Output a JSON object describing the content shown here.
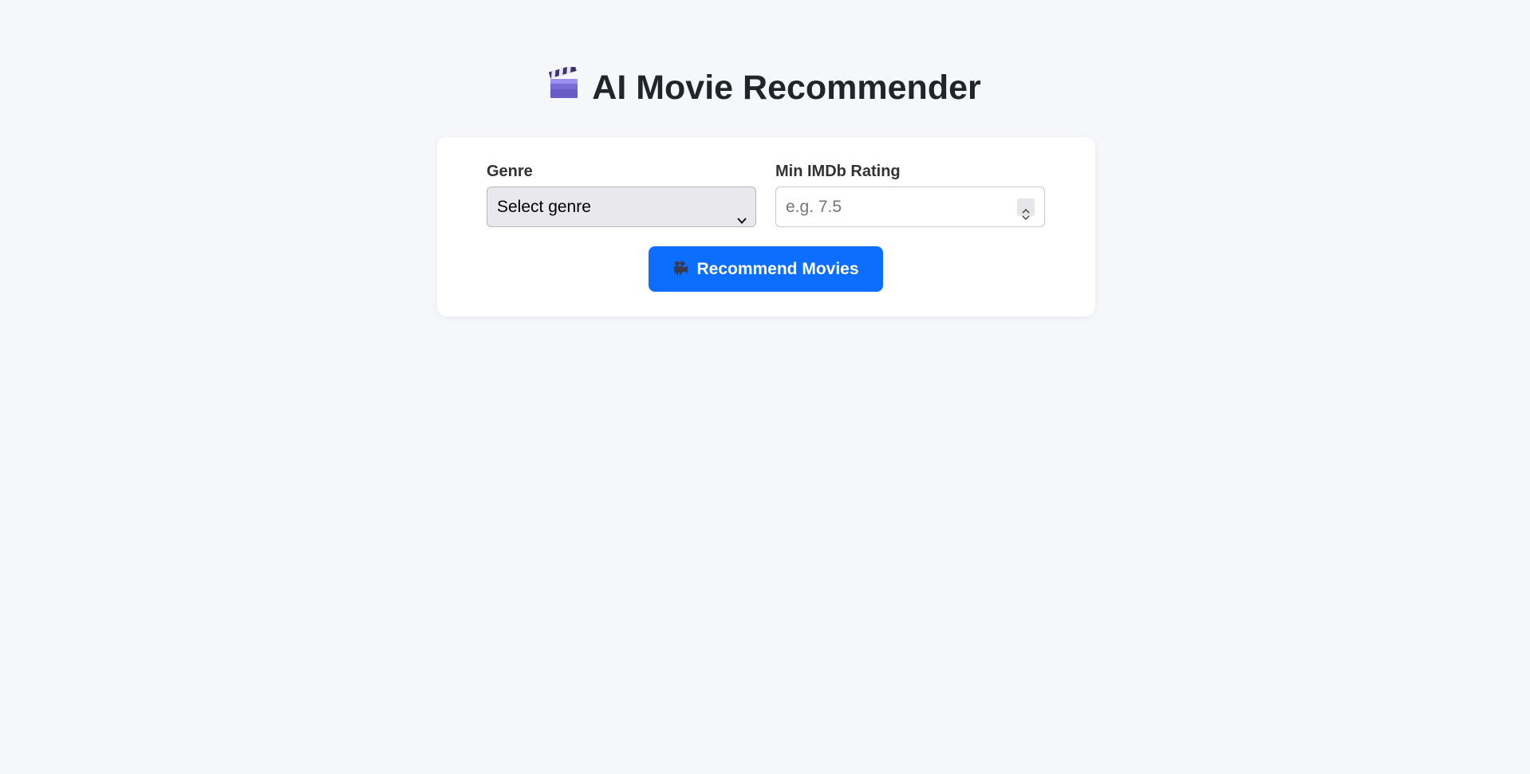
{
  "header": {
    "title": "AI Movie Recommender",
    "icon": "clapperboard-icon"
  },
  "form": {
    "genre": {
      "label": "Genre",
      "selected": "Select genre"
    },
    "rating": {
      "label": "Min IMDb Rating",
      "placeholder": "e.g. 7.5",
      "value": ""
    },
    "submit": {
      "label": "Recommend Movies",
      "icon": "movie-camera-icon"
    }
  },
  "colors": {
    "background": "#f5f7fa",
    "card": "#ffffff",
    "accent": "#0d6efd",
    "clapper": "#7b6bd6"
  }
}
